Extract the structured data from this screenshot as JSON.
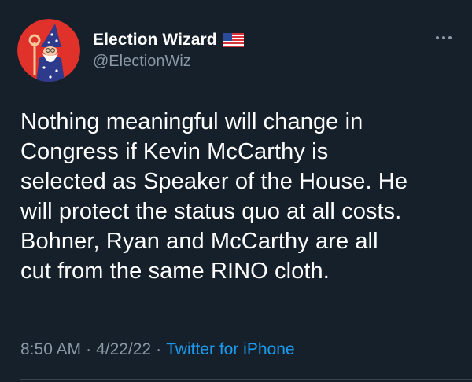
{
  "theme": {
    "background": "#15202b",
    "text_primary": "#ffffff",
    "text_secondary": "#8b98a5",
    "accent": "#1d9bf0",
    "avatar_bg": "#e0312b"
  },
  "author": {
    "display_name": "Election Wizard",
    "name_emoji": "flag-us-icon",
    "handle": "@ElectionWiz",
    "avatar": "wizard-avatar-icon"
  },
  "more_menu": {
    "icon": "more-options-icon"
  },
  "tweet": {
    "lines": [
      "Nothing meaningful will change in",
      "Congress if Kevin McCarthy is",
      "selected as Speaker of the House. He",
      "will protect the status quo at all costs.",
      "Bohner, Ryan and McCarthy are all",
      "cut from the same RINO cloth."
    ]
  },
  "meta": {
    "time": "8:50 AM",
    "separator": "·",
    "date": "4/22/22",
    "source": "Twitter for iPhone"
  }
}
